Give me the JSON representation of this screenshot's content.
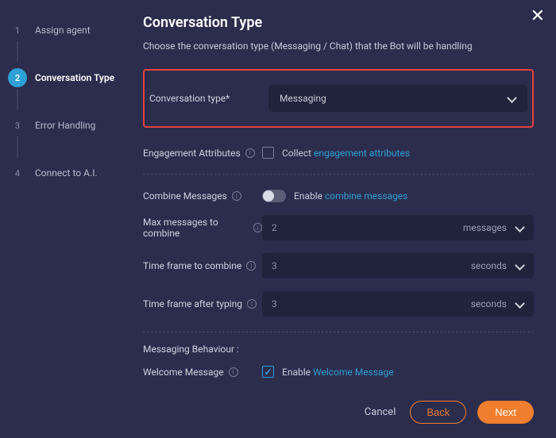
{
  "sidebar": {
    "steps": [
      {
        "num": "1",
        "label": "Assign agent"
      },
      {
        "num": "2",
        "label": "Conversation Type"
      },
      {
        "num": "3",
        "label": "Error Handling"
      },
      {
        "num": "4",
        "label": "Connect to A.I."
      }
    ],
    "active_index": 1
  },
  "header": {
    "title": "Conversation Type",
    "subtitle": "Choose the conversation type (Messaging / Chat) that the Bot will be handling"
  },
  "form": {
    "conv_type": {
      "label": "Conversation type*",
      "value": "Messaging"
    },
    "engagement": {
      "label": "Engagement Attributes",
      "checked": false,
      "text_before": "Collect ",
      "link": "engagement attributes"
    },
    "combine": {
      "label": "Combine Messages",
      "toggle": false,
      "text_before": "Enable ",
      "link": "combine messages"
    },
    "max_messages": {
      "label": "Max messages to combine",
      "value": "2",
      "unit": "messages"
    },
    "time_combine": {
      "label": "Time frame to combine",
      "value": "3",
      "unit": "seconds"
    },
    "time_after_typing": {
      "label": "Time frame after typing",
      "value": "3",
      "unit": "seconds"
    },
    "behaviour_title": "Messaging Behaviour :",
    "welcome": {
      "label": "Welcome Message",
      "checked": true,
      "text_before": "Enable ",
      "link": "Welcome Message"
    }
  },
  "footer": {
    "cancel": "Cancel",
    "back": "Back",
    "next": "Next"
  }
}
